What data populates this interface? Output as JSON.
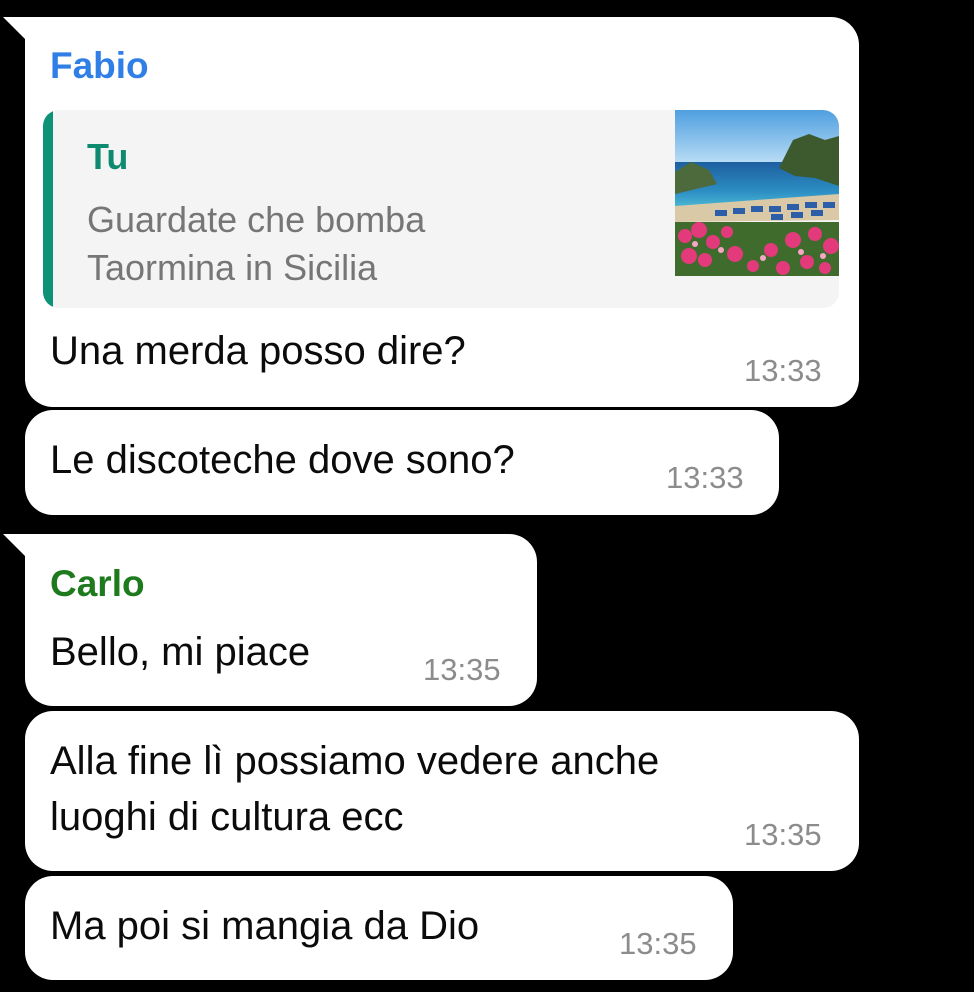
{
  "messages": [
    {
      "sender": "Fabio",
      "quote": {
        "author": "Tu",
        "text_line1": "Guardate che bomba",
        "text_line2": "Taormina in Sicilia",
        "thumbnail": "beach-photo"
      },
      "text": "Una merda posso dire?",
      "time": "13:33"
    },
    {
      "text": "Le discoteche dove sono?",
      "time": "13:33"
    },
    {
      "sender": "Carlo",
      "text": "Bello, mi piace",
      "time": "13:35"
    },
    {
      "text_line1": "Alla fine lì possiamo vedere anche",
      "text_line2": "luoghi di cultura ecc",
      "time": "13:35"
    },
    {
      "text": "Ma poi si mangia da Dio",
      "time": "13:35"
    }
  ],
  "colors": {
    "fabio_name": "#2f7fe6",
    "carlo_name": "#1d7a1d",
    "quote_bar": "#0e9277",
    "bubble": "#ffffff",
    "background": "#000000"
  }
}
